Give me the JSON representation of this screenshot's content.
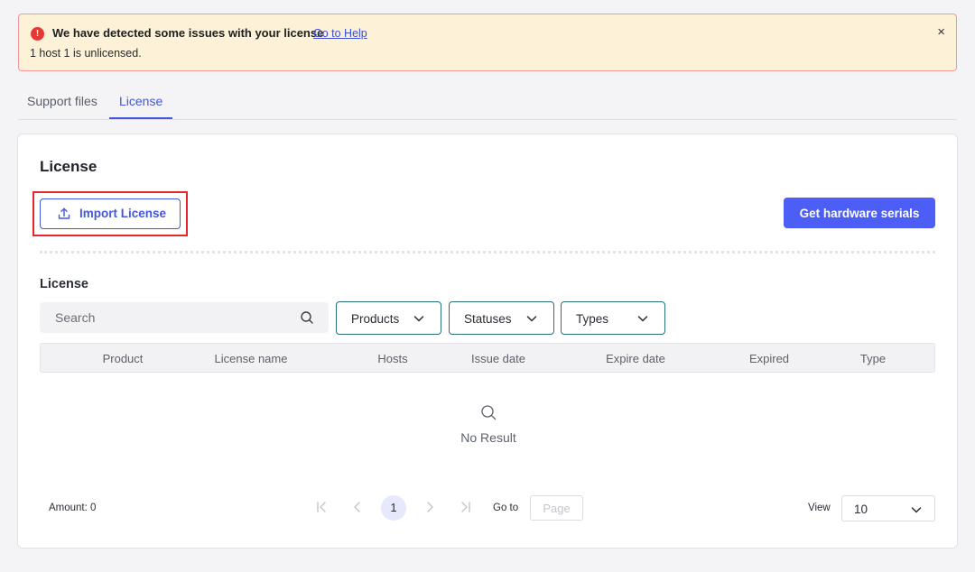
{
  "alert": {
    "title": "We have detected some issues with your license",
    "link": "Go to Help",
    "message": "1 host 1 is unlicensed.",
    "icon": "error-icon",
    "close": "×"
  },
  "tabs": [
    {
      "label": "Support files",
      "active": false
    },
    {
      "label": "License",
      "active": true
    }
  ],
  "card": {
    "title": "License",
    "import_button": "Import License",
    "hardware_button": "Get hardware serials",
    "section_title": "License"
  },
  "filters": {
    "search_placeholder": "Search",
    "products": "Products",
    "statuses": "Statuses",
    "types": "Types"
  },
  "table": {
    "columns": [
      "Product",
      "License name",
      "Hosts",
      "Issue date",
      "Expire date",
      "Expired",
      "Type"
    ],
    "rows": [],
    "empty_text": "No Result"
  },
  "pagination": {
    "amount": "Amount: 0",
    "current_page": "1",
    "goto_label": "Go to",
    "page_placeholder": "Page",
    "view_label": "View",
    "view_value": "10"
  },
  "colors": {
    "accent": "#4256e0",
    "primary_button": "#4c5ef5",
    "alert_bg": "#fdf1d8",
    "alert_border": "#ef9a9a",
    "error": "#e53935",
    "highlight": "#e5262d"
  }
}
